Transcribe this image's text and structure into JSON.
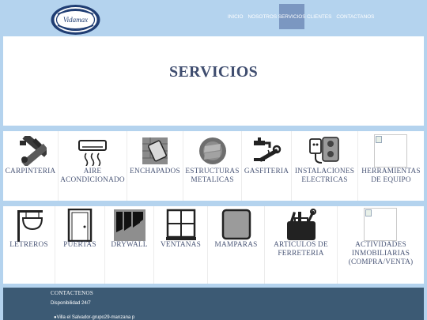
{
  "header": {
    "logo_text": "Vidamax",
    "nav": [
      {
        "label": "INICIO",
        "active": false
      },
      {
        "label": "NOSOTROS",
        "active": false
      },
      {
        "label": "SERVICIOS",
        "active": true
      },
      {
        "label": "CLIENTES",
        "active": false
      },
      {
        "label": "CONTACTANOS",
        "active": false
      }
    ]
  },
  "hero": {
    "title": "SERVICIOS"
  },
  "services_row1": [
    {
      "label": "CARPINTERIA",
      "icon": "carpentry-tools-icon"
    },
    {
      "label": "AIRE ACONDICIONADO",
      "icon": "air-conditioner-icon"
    },
    {
      "label": "ENCHAPADOS",
      "icon": "tile-trowel-icon"
    },
    {
      "label": "ESTRUCTURAS METALICAS",
      "icon": "metal-structure-icon"
    },
    {
      "label": "GASFITERIA",
      "icon": "faucet-wrench-icon"
    },
    {
      "label": "INSTALACIONES ELECTRICAS",
      "icon": "electrical-outlet-icon"
    },
    {
      "label": "HERRAMIENTAS DE EQUIPO",
      "icon": "broken-image-icon"
    }
  ],
  "services_row2": [
    {
      "label": "LETREROS",
      "icon": "signboard-icon"
    },
    {
      "label": "PUERTAS",
      "icon": "door-icon"
    },
    {
      "label": "DRYWALL",
      "icon": "drywall-panels-icon"
    },
    {
      "label": "VENTANAS",
      "icon": "window-icon"
    },
    {
      "label": "MAMPARAS",
      "icon": "partition-screen-icon"
    },
    {
      "label": "ARTICULOS DE FERRETERIA",
      "icon": "hardware-toolbox-icon"
    },
    {
      "label": "ACTIVIDADES INMOBILIARIAS (COMPRA/VENTA)",
      "icon": "broken-image-icon"
    }
  ],
  "footer": {
    "title": "CONTACTENOS",
    "availability": "Disponibilidad 24/7",
    "address": "Villa el Salvador-grupo29-manzana p"
  },
  "colors": {
    "header_bg": "#b4d3ee",
    "nav_active": "#7b97c1",
    "title_text": "#3f4d6f",
    "footer_bg": "#3c5a74"
  }
}
